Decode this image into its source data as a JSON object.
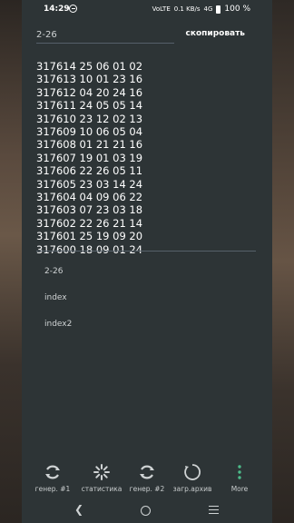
{
  "status": {
    "time": "14:29",
    "net1": "VoLTE",
    "net2": "0.1 KB/s",
    "net3": "4G",
    "battery": "100 %"
  },
  "search": {
    "value": "2-26",
    "placeholder": ""
  },
  "toolbar": {
    "copy_label": "скопировать"
  },
  "results": [
    "317614 25 06 01 02",
    "317613 10 01 23 16",
    "317612 04 20 24 16",
    "317611 24 05 05 14",
    "317610 23 12 02 13",
    "317609 10 06 05 04",
    "317608 01 21 21 16",
    "317607 19 01 03 19",
    "317606 22 26 05 11",
    "317605 23 03 14 24",
    "317604 04 09 06 22",
    "317603 07 23 03 18",
    "317602 22 26 21 14",
    "317601 25 19 09 20",
    "317600 18 09 01 24"
  ],
  "files": [
    "2-26",
    "index",
    "index2"
  ],
  "nav": [
    {
      "label": "генер. #1",
      "icon": "generator-1-icon"
    },
    {
      "label": "статистика",
      "icon": "statistics-icon"
    },
    {
      "label": "генер. #2",
      "icon": "generator-2-icon"
    },
    {
      "label": "загр.архив",
      "icon": "load-archive-icon"
    },
    {
      "label": "More",
      "icon": "more-icon"
    }
  ],
  "colors": {
    "background": "#2d3436",
    "text": "#ffffff",
    "muted": "#cfd3d4",
    "more_icon": "#4cbb8a"
  }
}
